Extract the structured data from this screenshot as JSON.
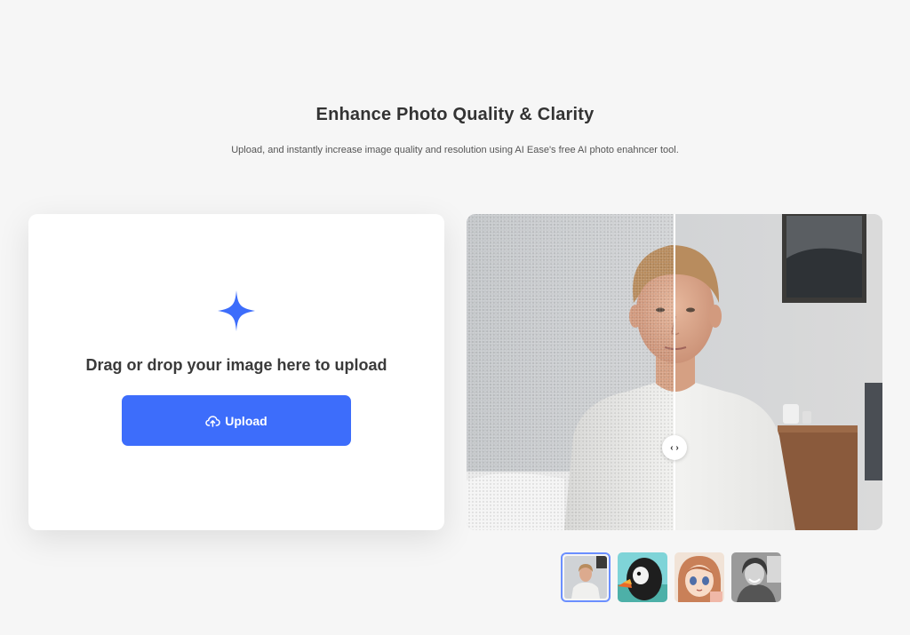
{
  "hero": {
    "title": "Enhance Photo Quality & Clarity",
    "subtitle": "Upload, and instantly increase image quality and resolution using AI Ease's free AI photo enahncer tool."
  },
  "upload_panel": {
    "drop_text": "Drag or drop your image here to upload",
    "upload_label": "Upload",
    "icons": [
      "sparkle-icon",
      "cloud-upload-icon"
    ],
    "accent_color": "#3d6dfb"
  },
  "compare": {
    "handle_glyph": "‹ ›",
    "icons": [
      "compare-handle-icon"
    ]
  },
  "samples": {
    "items": [
      {
        "name": "portrait-young-man",
        "selected": true
      },
      {
        "name": "puffin-bird",
        "selected": false
      },
      {
        "name": "anime-girl",
        "selected": false
      },
      {
        "name": "bw-woman-portrait",
        "selected": false
      }
    ]
  }
}
